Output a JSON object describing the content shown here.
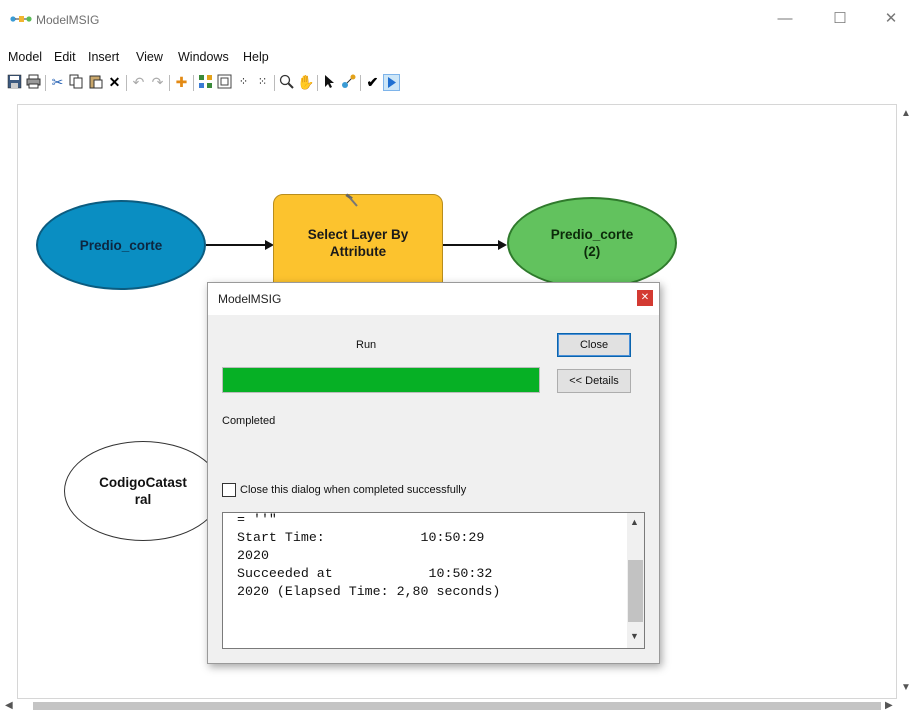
{
  "window": {
    "title": "ModelMSIG",
    "minimize_glyph": "—",
    "maximize_glyph": "☐",
    "close_glyph": "✕"
  },
  "menu": [
    "Model",
    "Edit",
    "Insert",
    "View",
    "Windows",
    "Help"
  ],
  "toolbar_icons": [
    "save-icon",
    "print-icon",
    "cut-icon",
    "copy-icon",
    "paste-icon",
    "delete-icon",
    "undo-icon",
    "redo-icon",
    "add-data-icon",
    "auto-layout-icon",
    "full-extent-icon",
    "zoom-in-fixed-icon",
    "zoom-out-fixed-icon",
    "zoom-icon",
    "pan-icon",
    "select-icon",
    "connect-icon",
    "validate-icon",
    "run-icon"
  ],
  "model": {
    "nodes": {
      "input": "Predio_corte",
      "tool": "Select Layer By\nAttribute",
      "output": "Predio_corte\n(2)",
      "parameter": "CodigoCatast\nral"
    },
    "colors": {
      "input": "#0a8ec2",
      "tool": "#fcc32e",
      "output": "#62c25e",
      "parameter": "#ffffff"
    }
  },
  "dialog": {
    "title": "ModelMSIG",
    "run_label": "Run",
    "close_button": "Close",
    "details_button": "<< Details",
    "progress": 1.0,
    "progress_color": "#06b025",
    "status": "Completed",
    "checkbox_label": "Close this dialog when completed successfully",
    "checkbox_checked": false,
    "log": [
      "= ''\"",
      "Start Time:            10:50:29",
      "2020",
      "Succeeded at            10:50:32",
      "2020 (Elapsed Time: 2,80 seconds)"
    ]
  }
}
